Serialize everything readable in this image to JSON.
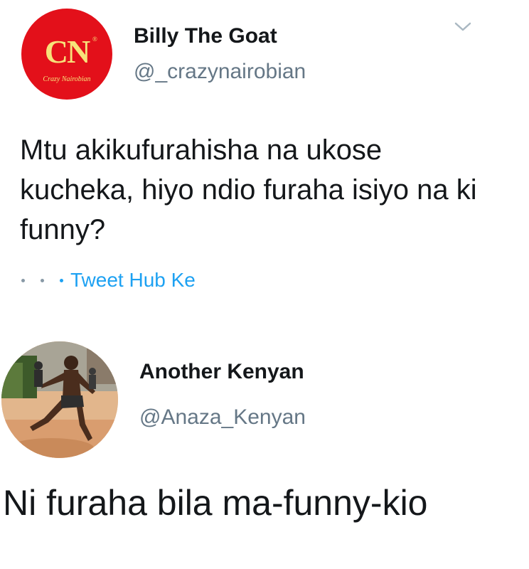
{
  "tweet": {
    "avatar_logo_text": "CN",
    "avatar_logo_script": "Crazy Nairobian",
    "display_name": "Billy The Goat",
    "handle": "@_crazynairobian",
    "text": "Mtu akikufurahisha na ukose kucheka, hiyo ndio furaha isiyo na ki funny?",
    "source": "Tweet Hub Ke",
    "menu_icon": "chevron-down-icon"
  },
  "reply": {
    "display_name": "Another Kenyan",
    "handle": "@Anaza_Kenyan",
    "text": "Ni furaha bila ma-funny-kio"
  },
  "colors": {
    "brand_red": "#e3101a",
    "link_blue": "#1da1f2",
    "handle_gray": "#657786",
    "text_dark": "#14171a"
  }
}
